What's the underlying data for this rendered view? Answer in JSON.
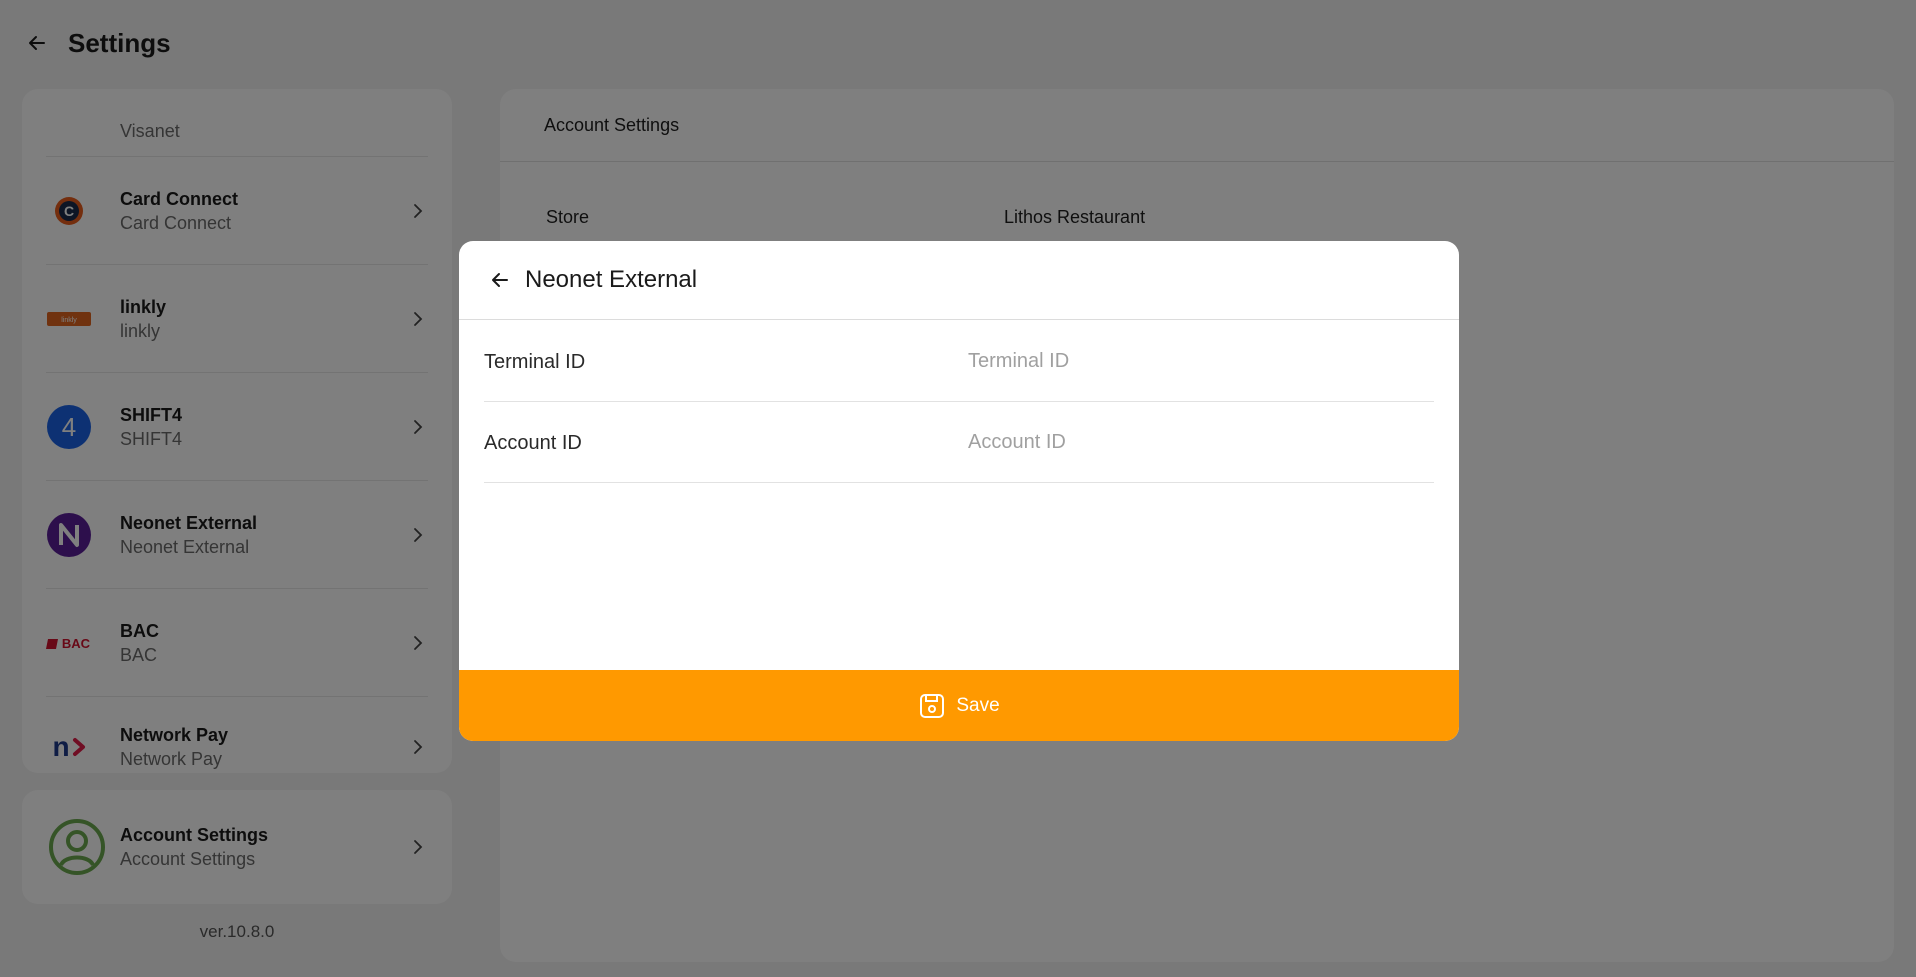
{
  "header": {
    "title": "Settings",
    "back_icon": "arrow-left-icon"
  },
  "sidebar": {
    "items": [
      {
        "name": "",
        "sub": "Visanet",
        "icon": "visanet-logo"
      },
      {
        "name": "Card Connect",
        "sub": "Card Connect",
        "icon": "card-connect-logo"
      },
      {
        "name": "linkly",
        "sub": "linkly",
        "icon": "linkly-logo",
        "logo_text": "linkly"
      },
      {
        "name": "SHIFT4",
        "sub": "SHIFT4",
        "icon": "shift4-logo",
        "logo_text": "4"
      },
      {
        "name": "Neonet External",
        "sub": "Neonet External",
        "icon": "neonet-logo"
      },
      {
        "name": "BAC",
        "sub": "BAC",
        "icon": "bac-logo",
        "logo_text": "BAC"
      },
      {
        "name": "Network Pay",
        "sub": "Network Pay",
        "icon": "network-pay-logo",
        "logo_text": "n"
      }
    ],
    "account": {
      "name": "Account Settings",
      "sub": "Account Settings",
      "icon": "user-circle-icon"
    },
    "version": "ver.10.8.0"
  },
  "main": {
    "title": "Account Settings",
    "rows": [
      {
        "label": "Store",
        "value": "Lithos Restaurant"
      }
    ]
  },
  "modal": {
    "title": "Neonet External",
    "fields": [
      {
        "label": "Terminal ID",
        "value": "",
        "placeholder": "Terminal ID"
      },
      {
        "label": "Account ID",
        "value": "",
        "placeholder": "Account ID"
      }
    ],
    "save_label": "Save",
    "save_icon": "save-icon"
  },
  "colors": {
    "accent": "#ff9900",
    "overlay": "rgba(0,0,0,0.5)",
    "background": "#f2f2f2"
  }
}
